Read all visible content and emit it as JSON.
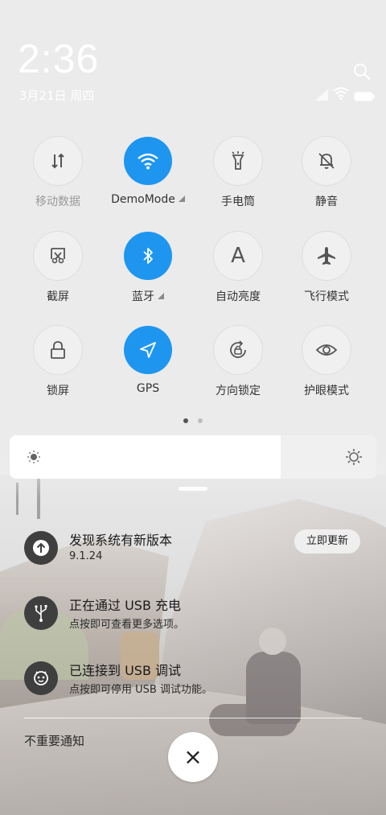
{
  "status": {
    "time": "2:36",
    "date": "3月21日 周四"
  },
  "toggles": [
    {
      "label": "移动数据",
      "icon": "mobile-data-icon",
      "active": false
    },
    {
      "label": "DemoMode",
      "icon": "wifi-icon",
      "active": true
    },
    {
      "label": "手电筒",
      "icon": "flashlight-icon",
      "active": false
    },
    {
      "label": "静音",
      "icon": "mute-bell-icon",
      "active": false
    },
    {
      "label": "截屏",
      "icon": "screenshot-icon",
      "active": false
    },
    {
      "label": "蓝牙",
      "icon": "bluetooth-icon",
      "active": true
    },
    {
      "label": "自动亮度",
      "icon": "auto-brightness-icon",
      "active": false
    },
    {
      "label": "飞行模式",
      "icon": "airplane-icon",
      "active": false
    },
    {
      "label": "锁屏",
      "icon": "lock-icon",
      "active": false
    },
    {
      "label": "GPS",
      "icon": "gps-icon",
      "active": true
    },
    {
      "label": "方向锁定",
      "icon": "rotation-lock-icon",
      "active": false
    },
    {
      "label": "护眼模式",
      "icon": "eye-icon",
      "active": false
    }
  ],
  "toggle_glyphs": {
    "auto_brightness": "A"
  },
  "page_indicator": {
    "current": 1,
    "total": 2
  },
  "brightness": {
    "level": 0.74
  },
  "notifications": [
    {
      "title": "发现系统有新版本",
      "subtitle": "9.1.24",
      "action": "立即更新",
      "icon": "update-arrow-icon"
    },
    {
      "title": "正在通过 USB 充电",
      "subtitle": "点按即可查看更多选项。",
      "icon": "usb-icon"
    },
    {
      "title": "已连接到 USB 调试",
      "subtitle": "点按即可停用 USB 调试功能。",
      "icon": "debug-bug-icon"
    }
  ],
  "footer": {
    "unimportant_label": "不重要通知",
    "close_glyph": "×"
  },
  "colors": {
    "accent": "#1e96f0",
    "tile_bg": "#f0f0f0"
  }
}
